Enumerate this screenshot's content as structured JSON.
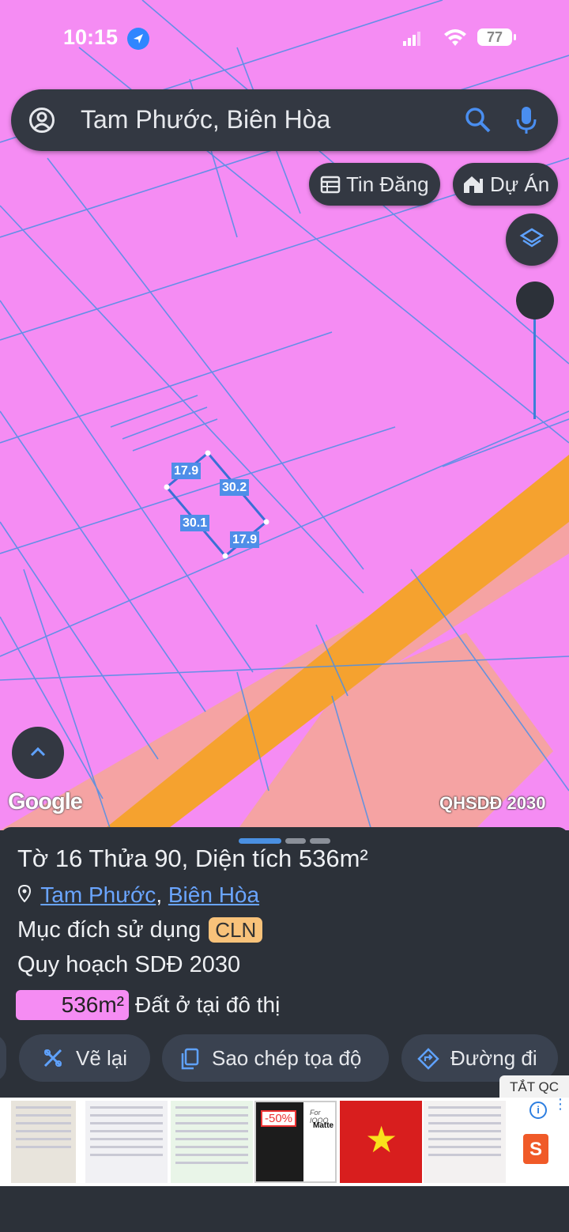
{
  "status_bar": {
    "time": "10:15",
    "battery": "77"
  },
  "search": {
    "text": "Tam Phước, Biên Hòa"
  },
  "chips": {
    "listings": "Tin Đăng",
    "projects": "Dự Án"
  },
  "map": {
    "dimensions": {
      "top": "17.9",
      "right": "30.2",
      "left": "30.1",
      "bottom": "17.9"
    },
    "watermark": "Google",
    "layer_name": "QHSDĐ 2030",
    "colors": {
      "residential_pink": "#f58cf3",
      "road_orange": "#f5a22f",
      "salmon": "#f5a3a3",
      "parcel_line": "#4d8fe6"
    }
  },
  "parcel": {
    "title": "Tờ 16 Thửa 90, Diện tích 536m²",
    "ward": "Tam Phước",
    "separator": ",",
    "city": "Biên Hòa",
    "purpose_label": "Mục đích sử dụng",
    "purpose_code": "CLN",
    "plan_label": "Quy hoạch SDĐ 2030",
    "zone_area": "536m²",
    "zone_name": "Đất ở tại đô thị"
  },
  "actions": {
    "redraw": "Vẽ lại",
    "copy_coords": "Sao chép tọa độ",
    "directions": "Đường đi"
  },
  "ad": {
    "close_label": "TẮT QC",
    "discount": "-50%",
    "brand_text": "For IQOO",
    "product_text": "Matte",
    "info_label": "i",
    "shop_label": "S"
  }
}
